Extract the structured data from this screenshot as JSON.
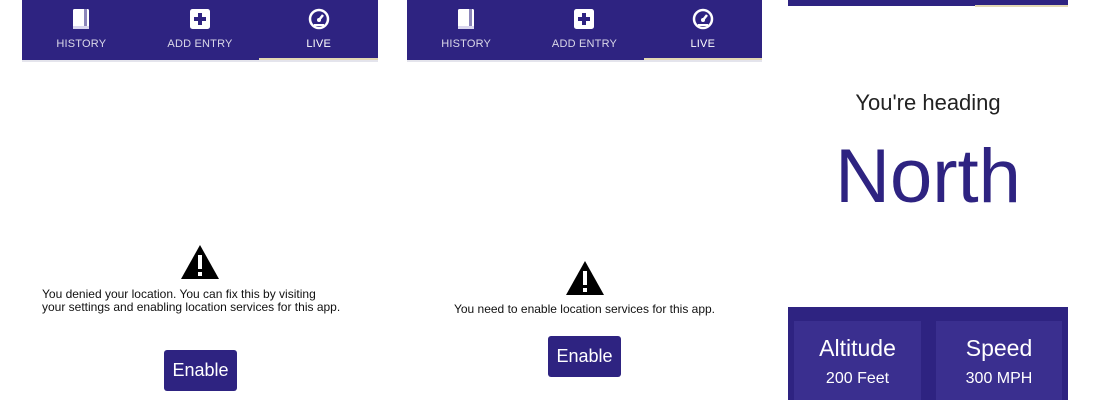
{
  "screens": [
    {
      "tabs": [
        {
          "label": "HISTORY",
          "icon": "book-icon"
        },
        {
          "label": "ADD ENTRY",
          "icon": "plus-square-icon"
        },
        {
          "label": "LIVE",
          "icon": "speedometer-icon",
          "active": true
        }
      ],
      "message": "You denied your location. You can fix this by visiting your settings and enabling location services for this app.",
      "button_label": "Enable"
    },
    {
      "tabs": [
        {
          "label": "HISTORY",
          "icon": "book-icon"
        },
        {
          "label": "ADD ENTRY",
          "icon": "plus-square-icon"
        },
        {
          "label": "LIVE",
          "icon": "speedometer-icon",
          "active": true
        }
      ],
      "message": "You need to enable location services for this app.",
      "button_label": "Enable"
    },
    {
      "heading_label": "You're heading",
      "direction": "North",
      "stats": [
        {
          "title": "Altitude",
          "value": "200 Feet"
        },
        {
          "title": "Speed",
          "value": "300 MPH"
        }
      ]
    }
  ],
  "colors": {
    "primary": "#2e2381",
    "card": "#3a2f8f",
    "tab_indicator": "#e3d8b3"
  }
}
